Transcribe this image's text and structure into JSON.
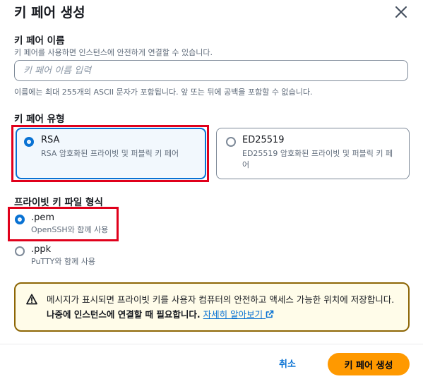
{
  "dialog": {
    "title": "키 페어 생성",
    "close_icon": "close-icon"
  },
  "key_name": {
    "label": "키 페어 이름",
    "description": "키 페어를 사용하면 인스턴스에 안전하게 연결할 수 있습니다.",
    "placeholder": "키 페어 이름 입력",
    "value": "",
    "constraint": "이름에는 최대 255개의 ASCII 문자가 포함됩니다. 앞 또는 뒤에 공백을 포함할 수 없습니다."
  },
  "key_type": {
    "label": "키 페어 유형",
    "options": [
      {
        "title": "RSA",
        "description": "RSA 암호화된 프라이빗 및 퍼블릭 키 페어",
        "selected": true
      },
      {
        "title": "ED25519",
        "description": "ED25519 암호화된 프라이빗 및 퍼블릭 키 페어",
        "selected": false
      }
    ]
  },
  "file_format": {
    "label": "프라이빗 키 파일 형식",
    "options": [
      {
        "title": ".pem",
        "description": "OpenSSH와 함께 사용",
        "selected": true
      },
      {
        "title": ".ppk",
        "description": "PuTTY와 함께 사용",
        "selected": false
      }
    ]
  },
  "alert": {
    "icon": "warning-icon",
    "text": "메시지가 표시되면 프라이빗 키를 사용자 컴퓨터의 안전하고 액세스 가능한 위치에 저장합니다.",
    "emphasis": "나중에 인스턴스에 연결할 때 필요합니다.",
    "link": "자세히 알아보기",
    "link_icon": "external-link-icon"
  },
  "footer": {
    "cancel": "취소",
    "submit": "키 페어 생성"
  },
  "colors": {
    "accent": "#0972d3",
    "primary_button": "#ff9900",
    "highlight_box": "#e0001b",
    "alert_border": "#8d6605",
    "alert_bg": "#fffce9"
  }
}
